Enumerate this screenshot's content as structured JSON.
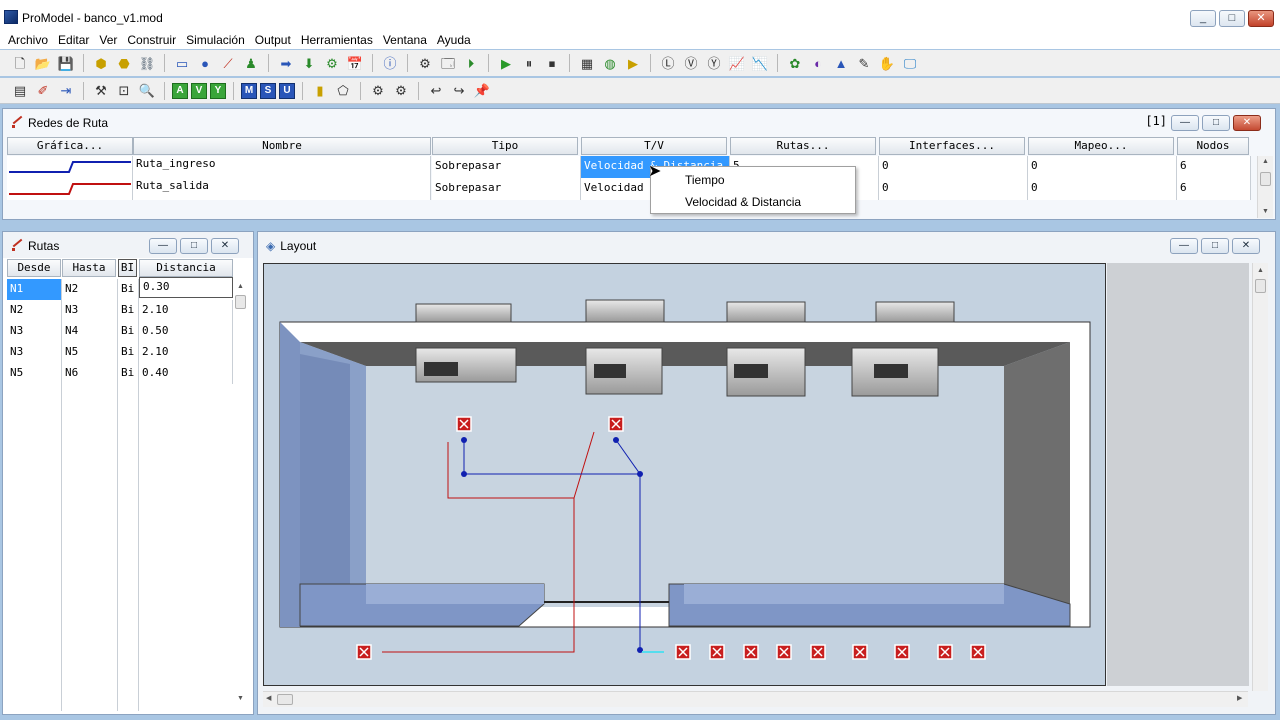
{
  "window": {
    "title": "ProModel - banco_v1.mod"
  },
  "menu": [
    "Archivo",
    "Editar",
    "Ver",
    "Construir",
    "Simulación",
    "Output",
    "Herramientas",
    "Ventana",
    "Ayuda"
  ],
  "toolbar_letters": {
    "a": "A",
    "v": "V",
    "y": "Y",
    "m": "M",
    "s": "S",
    "u": "U"
  },
  "network_panel": {
    "title": "Redes de Ruta",
    "index": "[1]",
    "columns": [
      "Gráfica...",
      "Nombre",
      "Tipo",
      "T/V",
      "Rutas...",
      "Interfaces...",
      "Mapeo...",
      "Nodos"
    ],
    "rows": [
      {
        "name": "Ruta_ingreso",
        "type": "Sobrepasar",
        "tv": "Velocidad & Distancia",
        "routes": "5",
        "interfaces": "0",
        "mapping": "0",
        "nodes": "6",
        "color": "#1020b0"
      },
      {
        "name": "Ruta_salida",
        "type": "Sobrepasar",
        "tv": "Velocidad",
        "routes": "",
        "interfaces": "0",
        "mapping": "0",
        "nodes": "6",
        "color": "#c01010"
      }
    ]
  },
  "context_menu": {
    "items": [
      "Tiempo",
      "Velocidad & Distancia"
    ]
  },
  "routes_panel": {
    "title": "Rutas",
    "columns": [
      "Desde",
      "Hasta",
      "BI",
      "Distancia"
    ],
    "rows": [
      {
        "from": "N1",
        "to": "N2",
        "bi": "Bi",
        "distance": "0.30"
      },
      {
        "from": "N2",
        "to": "N3",
        "bi": "Bi",
        "distance": "2.10"
      },
      {
        "from": "N3",
        "to": "N4",
        "bi": "Bi",
        "distance": "0.50"
      },
      {
        "from": "N3",
        "to": "N5",
        "bi": "Bi",
        "distance": "2.10"
      },
      {
        "from": "N5",
        "to": "N6",
        "bi": "Bi",
        "distance": "0.40"
      }
    ]
  },
  "layout_panel": {
    "title": "Layout"
  },
  "colors": {
    "accent_selection": "#3399ff",
    "route_in": "#1020b0",
    "route_out": "#c01010",
    "node_marker": "#c81e1e"
  }
}
